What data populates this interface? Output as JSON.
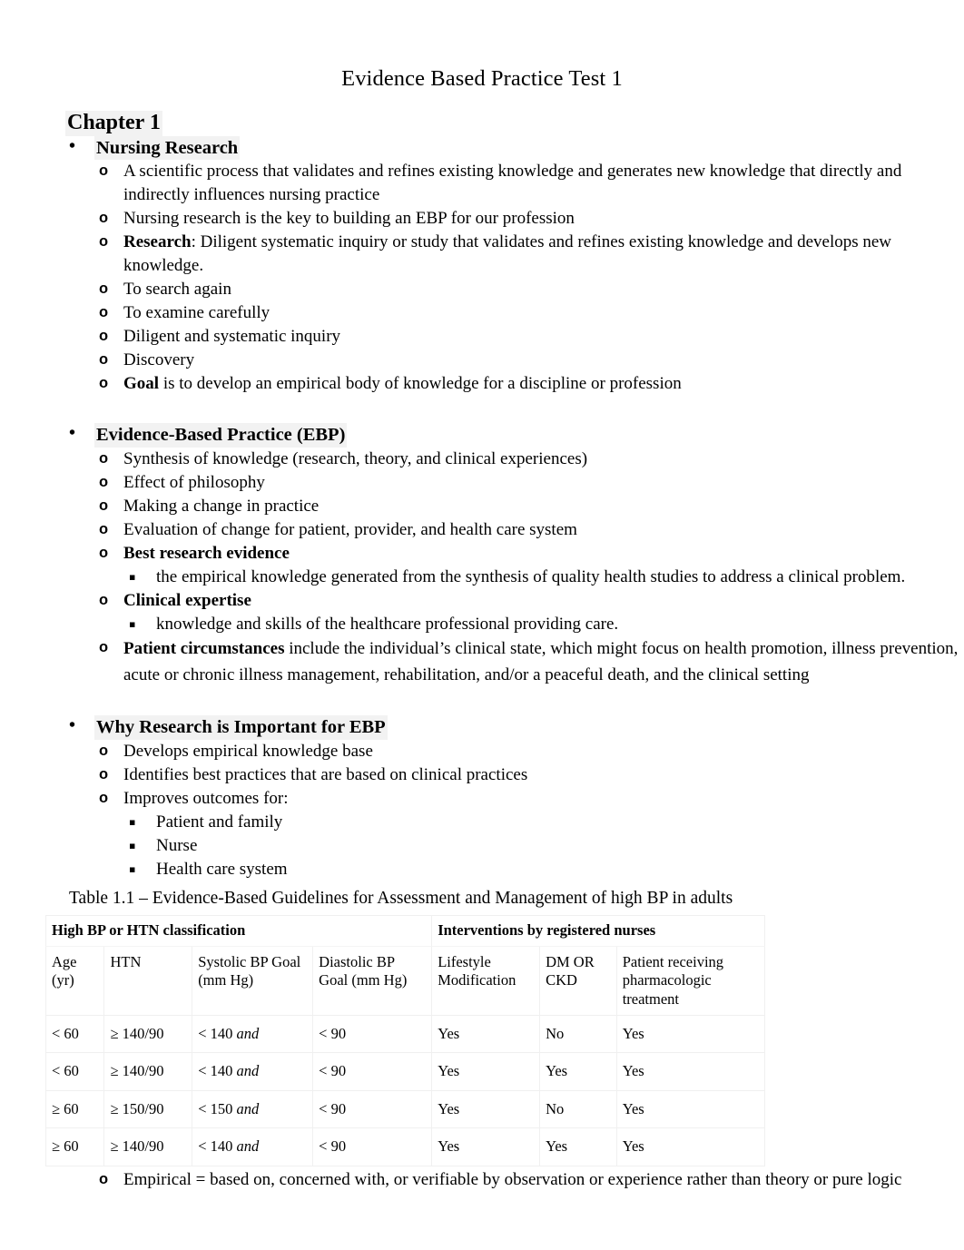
{
  "document": {
    "title": "Evidence Based Practice Test 1",
    "chapter_heading": "Chapter 1"
  },
  "sections": [
    {
      "heading": "Nursing Research",
      "bullet_marker": "•",
      "items": [
        {
          "marker": "o",
          "text": "A scientific process that validates and refines existing knowledge and generates new knowledge that directly and indirectly influences nursing practice"
        },
        {
          "marker": "o",
          "text": "Nursing research is the key to building an EBP for our profession"
        },
        {
          "marker": "o",
          "bold_lead": "Research",
          "text": ": Diligent systematic inquiry or study that validates and refines existing knowledge and develops new knowledge."
        },
        {
          "marker": "o",
          "text": "To search again"
        },
        {
          "marker": "o",
          "text": "To examine carefully"
        },
        {
          "marker": "o",
          "text": "Diligent and systematic inquiry"
        },
        {
          "marker": "o",
          "text": "Discovery"
        },
        {
          "marker": "o",
          "bold_lead": "Goal",
          "text": " is to develop an empirical body of knowledge for a discipline or profession"
        }
      ]
    },
    {
      "heading": "Evidence-Based Practice (EBP)",
      "bullet_marker": "•",
      "items": [
        {
          "marker": "o",
          "text": "Synthesis of knowledge (research, theory, and clinical experiences)"
        },
        {
          "marker": "o",
          "text": "Effect of philosophy"
        },
        {
          "marker": "o",
          "text": "Making a change in practice"
        },
        {
          "marker": "o",
          "text": "Evaluation of change for patient, provider, and health care system"
        },
        {
          "marker": "o",
          "bold_lead": "Best research evidence",
          "text": ""
        },
        {
          "marker": "▪",
          "level": 3,
          "text": "the empirical knowledge generated from the synthesis of quality health studies to address a clinical problem."
        },
        {
          "marker": "o",
          "bold_lead": "Clinical expertise",
          "text": ""
        },
        {
          "marker": "▪",
          "level": 3,
          "text": "knowledge and skills of the healthcare professional providing care."
        },
        {
          "marker": "o",
          "bold_lead": "Patient circumstances",
          "text": " include the individual’s clinical state, which might focus on health promotion, illness prevention, acute or chronic illness management, rehabilitation, and/or a peaceful death, and the clinical setting"
        }
      ]
    },
    {
      "heading": "Why Research is Important for EBP",
      "bullet_marker": "•",
      "items": [
        {
          "marker": "o",
          "text": "Develops empirical knowledge base"
        },
        {
          "marker": "o",
          "text": "Identifies best practices that are based on clinical practices"
        },
        {
          "marker": "o",
          "text": "Improves outcomes for:"
        },
        {
          "marker": "▪",
          "level": 3,
          "text": "Patient and family"
        },
        {
          "marker": "▪",
          "level": 3,
          "text": "Nurse"
        },
        {
          "marker": "▪",
          "level": 3,
          "text": "Health care system"
        }
      ]
    }
  ],
  "table": {
    "caption": "Table 1.1 – Evidence-Based Guidelines for Assessment and Management of high BP in adults",
    "group_headers": [
      {
        "label": "High BP or HTN classification",
        "span": 4
      },
      {
        "label": "Interventions by registered nurses",
        "span": 3
      }
    ],
    "columns": [
      "Age (yr)",
      "HTN",
      "Systolic BP Goal (mm Hg)",
      "Diastolic BP Goal (mm Hg)",
      "Lifestyle Modification",
      "DM OR CKD",
      "Patient receiving pharmacologic treatment"
    ],
    "column_lines": [
      [
        "Age",
        "(yr)"
      ],
      [
        "HTN",
        ""
      ],
      [
        "Systolic BP Goal",
        "(mm Hg)"
      ],
      [
        "Diastolic BP",
        "Goal (mm Hg)"
      ],
      [
        "Lifestyle",
        "Modification"
      ],
      [
        "DM OR",
        "CKD"
      ],
      [
        "Patient receiving",
        "pharmacologic",
        "treatment"
      ]
    ],
    "rows": [
      {
        "age": "< 60",
        "htn": "≥ 140/90",
        "systolic": "< 140",
        "systolic_italic": "and",
        "diastolic": "< 90",
        "lifestyle": "Yes",
        "dm_ckd": "No",
        "pharmacologic": "Yes"
      },
      {
        "age": "< 60",
        "htn": "≥ 140/90",
        "systolic": "< 140",
        "systolic_italic": "and",
        "diastolic": "< 90",
        "lifestyle": "Yes",
        "dm_ckd": "Yes",
        "pharmacologic": "Yes"
      },
      {
        "age": "≥ 60",
        "htn": "≥ 150/90",
        "systolic": "< 150",
        "systolic_italic": "and",
        "diastolic": "< 90",
        "lifestyle": "Yes",
        "dm_ckd": "No",
        "pharmacologic": "Yes"
      },
      {
        "age": "≥ 60",
        "htn": "≥ 140/90",
        "systolic": "< 140",
        "systolic_italic": "and",
        "diastolic": "< 90",
        "lifestyle": "Yes",
        "dm_ckd": "Yes",
        "pharmacologic": "Yes"
      }
    ]
  },
  "footer_item": {
    "marker": "o",
    "text": "Empirical = based on, concerned with, or verifiable by observation or experience rather than theory or pure logic"
  },
  "colors": {
    "text": "#000000",
    "page_background": "#ffffff",
    "heading_highlight": "#f2f2f2",
    "table_rule": "#f0f0f0"
  }
}
